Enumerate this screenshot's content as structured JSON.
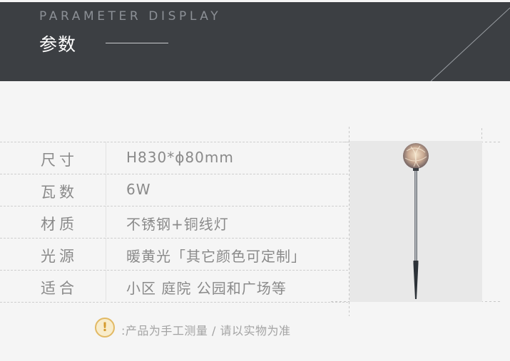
{
  "header": {
    "title_en": "PARAMETER DISPLAY",
    "title_cn": "参数"
  },
  "specs": [
    {
      "label": "尺寸",
      "value": "H830*ϕ80mm"
    },
    {
      "label": "瓦数",
      "value": "6W"
    },
    {
      "label": "材质",
      "value": "不锈钢+铜线灯"
    },
    {
      "label": "光源",
      "value": "暖黄光「其它颜色可定制」"
    },
    {
      "label": "适合",
      "value": "小区 庭院 公园和广场等"
    }
  ],
  "note": {
    "icon": "exclamation-icon",
    "text": ":产品为手工测量 / 请以实物为准"
  },
  "colors": {
    "header_bg": "#3c3f43",
    "accent_icon": "#e2b964"
  }
}
